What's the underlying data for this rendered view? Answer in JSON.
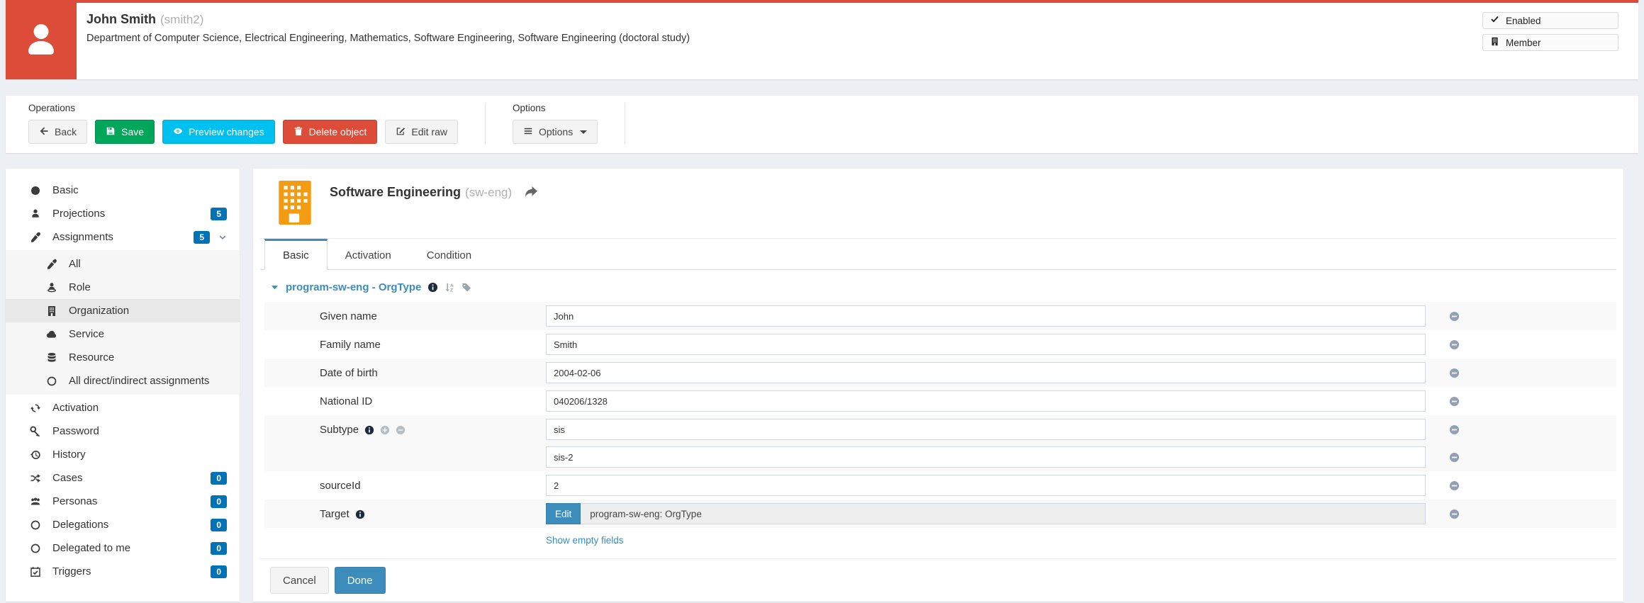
{
  "header": {
    "name": "John Smith",
    "username": "(smith2)",
    "subtitle": "Department of Computer Science, Electrical Engineering, Mathematics, Software Engineering, Software Engineering (doctoral study)",
    "avatar_icon": "user-icon",
    "accent_color": "#dd4b39",
    "badges": [
      {
        "label": "Enabled",
        "icon": "check-icon"
      },
      {
        "label": "Member",
        "icon": "building-icon"
      }
    ]
  },
  "operations": {
    "label": "Operations",
    "buttons": {
      "back": {
        "label": "Back",
        "icon": "arrow-left-icon",
        "color": "default"
      },
      "save": {
        "label": "Save",
        "icon": "floppy-icon",
        "color": "#00a65a"
      },
      "preview": {
        "label": "Preview changes",
        "icon": "eye-icon",
        "color": "#00c0ef"
      },
      "delete": {
        "label": "Delete object",
        "icon": "trash-icon",
        "color": "#dd4b39"
      },
      "editraw": {
        "label": "Edit raw",
        "icon": "edit-icon",
        "color": "default"
      }
    },
    "options_label": "Options",
    "options_button": {
      "label": "Options",
      "icon": "bars-icon"
    }
  },
  "sidebar": {
    "badge_color": "#0073b7",
    "items": [
      {
        "label": "Basic",
        "icon": "circle-icon"
      },
      {
        "label": "Projections",
        "icon": "user-icon",
        "badge": "5"
      },
      {
        "label": "Assignments",
        "icon": "eyedropper-icon",
        "badge": "5",
        "expanded": true
      },
      {
        "label": "All",
        "icon": "eyedropper-icon",
        "submenu": true
      },
      {
        "label": "Role",
        "icon": "role-icon",
        "submenu": true
      },
      {
        "label": "Organization",
        "icon": "building-icon",
        "submenu": true,
        "selected": true
      },
      {
        "label": "Service",
        "icon": "cloud-icon",
        "submenu": true
      },
      {
        "label": "Resource",
        "icon": "database-icon",
        "submenu": true
      },
      {
        "label": "All direct/indirect assignments",
        "icon": "circle-outline-icon",
        "submenu": true
      },
      {
        "label": "Activation",
        "icon": "refresh-icon"
      },
      {
        "label": "Password",
        "icon": "key-icon"
      },
      {
        "label": "History",
        "icon": "history-icon"
      },
      {
        "label": "Cases",
        "icon": "shuffle-icon",
        "badge": "0"
      },
      {
        "label": "Personas",
        "icon": "users-icon",
        "badge": "0"
      },
      {
        "label": "Delegations",
        "icon": "circle-outline-icon",
        "badge": "0"
      },
      {
        "label": "Delegated to me",
        "icon": "circle-outline-icon",
        "badge": "0"
      },
      {
        "label": "Triggers",
        "icon": "calendar-check-icon",
        "badge": "0"
      }
    ]
  },
  "content": {
    "title": "Software Engineering",
    "title_suffix": "(sw-eng)",
    "org_icon": "building-icon",
    "org_icon_color": "#f39c12",
    "share_icon": "share-icon",
    "tabs": [
      {
        "label": "Basic",
        "active": true
      },
      {
        "label": "Activation",
        "active": false
      },
      {
        "label": "Condition",
        "active": false
      }
    ],
    "section": {
      "title": "program-sw-eng - OrgType",
      "icons": [
        "info-icon",
        "sort-alpha-icon",
        "tag-icon"
      ]
    },
    "form": {
      "rows": [
        {
          "label": "Given name",
          "value": "John"
        },
        {
          "label": "Family name",
          "value": "Smith"
        },
        {
          "label": "Date of birth",
          "value": "2004-02-06"
        },
        {
          "label": "National ID",
          "value": "040206/1328"
        },
        {
          "label": "Subtype",
          "icons": [
            "info-icon",
            "plus-circle-icon",
            "minus-circle-icon"
          ],
          "values": [
            "sis",
            "sis-2"
          ]
        },
        {
          "label": "sourceId",
          "value": "2"
        },
        {
          "label": "Target",
          "icons": [
            "info-icon"
          ],
          "button_label": "Edit",
          "value": "program-sw-eng: OrgType"
        }
      ],
      "show_empty_label": "Show empty fields"
    },
    "footer": {
      "cancel_label": "Cancel",
      "done_label": "Done",
      "done_color": "#3c8dbc"
    }
  }
}
